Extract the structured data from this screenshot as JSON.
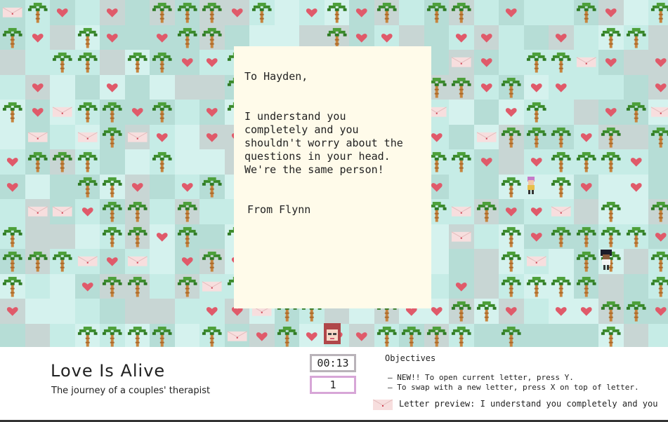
{
  "game": {
    "title": "Love Is Alive",
    "subtitle": "The journey of a couples' therapist",
    "timer": "00:13",
    "counter": "1"
  },
  "letter": {
    "greeting": "To Hayden,",
    "body": "I understand you\ncompletely and you\nshouldn't worry about the\nquestions in your head.\nWe're the same person!",
    "signoff": "From Flynn"
  },
  "objectives": {
    "title": "Objectives",
    "items": [
      "– NEW!! To open current letter, press Y.",
      "– To swap with a new letter, press X on top of letter."
    ],
    "preview_label": "Letter preview: I understand you completely and you"
  },
  "colors": {
    "tile_light": "#c6ece6",
    "tile_mid": "#b6ddd6",
    "tile_gray": "#c8d6d4",
    "heart": "#e05a6a",
    "envelope": "#f7dede",
    "letter_paper": "#fffbea",
    "box_border": "#d7a6d7"
  },
  "icons": [
    "palm-tree-icon",
    "heart-icon",
    "envelope-icon",
    "player-avatar",
    "npc-character"
  ]
}
